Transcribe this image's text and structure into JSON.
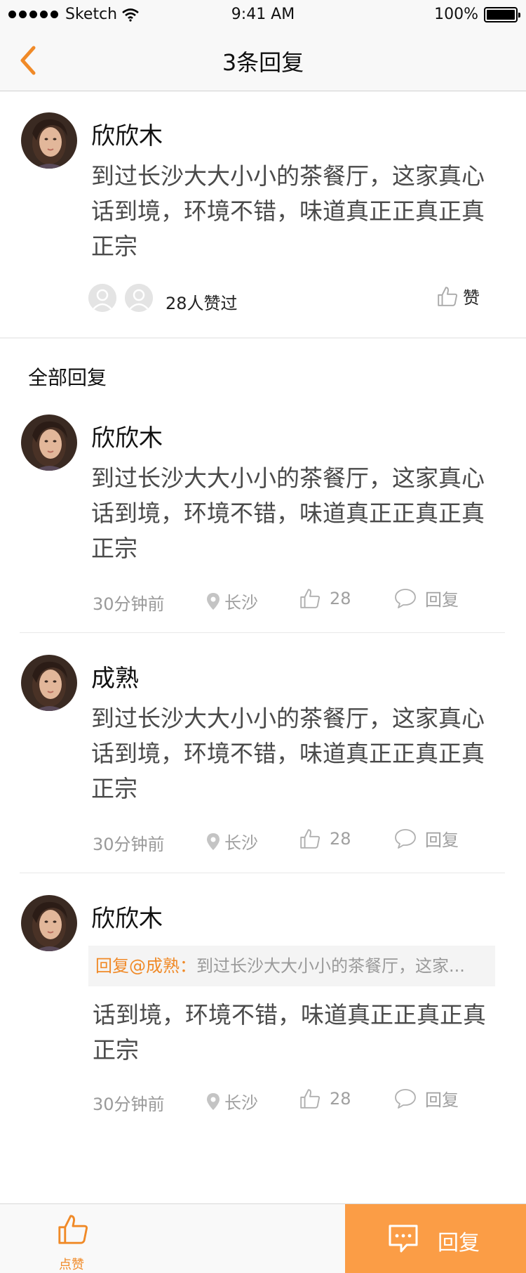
{
  "status_bar": {
    "carrier": "Sketch",
    "time": "9:41 AM",
    "battery": "100%"
  },
  "nav": {
    "title": "3条回复"
  },
  "post": {
    "author": "欣欣木",
    "text": "到过长沙大大小小的茶餐厅，这家真心话到境，环境不错，味道真正正真正真正宗",
    "like_count": "28人赞过",
    "like_label": "赞"
  },
  "section_title": "全部回复",
  "replies": [
    {
      "author": "欣欣木",
      "text": "到过长沙大大小小的茶餐厅，这家真心话到境，环境不错，味道真正正真正真正宗",
      "time": "30分钟前",
      "location": "长沙",
      "likes": "28",
      "reply_label": "回复"
    },
    {
      "author": "成熟",
      "text": "到过长沙大大小小的茶餐厅，这家真心话到境，环境不错，味道真正正真正真正宗",
      "time": "30分钟前",
      "location": "长沙",
      "likes": "28",
      "reply_label": "回复"
    },
    {
      "author": "欣欣木",
      "quote_prefix": "回复@成熟：",
      "quote_text": "到过长沙大大小小的茶餐厅，这家...",
      "text": "话到境，环境不错，味道真正正真正真正宗",
      "time": "30分钟前",
      "location": "长沙",
      "likes": "28",
      "reply_label": "回复"
    }
  ],
  "bottom_bar": {
    "like_label": "点赞",
    "reply_label": "回复"
  },
  "colors": {
    "accent": "#f08a28",
    "reply_button": "#fb9d46",
    "meta_gray": "#a0a0a0"
  },
  "icons": [
    "signal-dots-icon",
    "wifi-icon",
    "battery-icon",
    "back-chevron-icon",
    "thumbs-up-icon",
    "location-pin-icon",
    "comment-bubble-icon",
    "chat-bubble-icon"
  ]
}
